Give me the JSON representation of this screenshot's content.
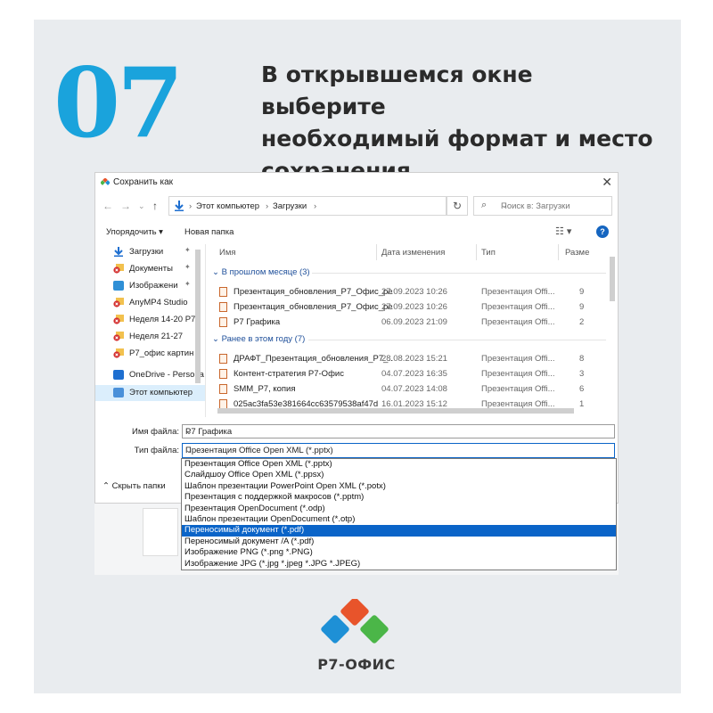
{
  "step": {
    "number": "07"
  },
  "headline": {
    "line1": "В открывшемся окне выберите",
    "line2": "необходимый формат и место",
    "line3": "сохранения"
  },
  "dialog": {
    "title": "Сохранить как",
    "close": "✕",
    "address": {
      "crumb1": "Этот компьютер",
      "crumb2": "Загрузки"
    },
    "search_placeholder": "Поиск в: Загрузки",
    "toolbar": {
      "organize": "Упорядочить ▾",
      "new_folder": "Новая папка",
      "help": "?"
    },
    "sidebar": [
      {
        "label": "Загрузки",
        "pin": true,
        "icon": "download-icon"
      },
      {
        "label": "Документы",
        "pin": true,
        "icon": "error-icon"
      },
      {
        "label": "Изображени",
        "pin": true,
        "icon": "pictures-icon"
      },
      {
        "label": "AnyMP4 Studio",
        "pin": false,
        "icon": "error-icon"
      },
      {
        "label": "Неделя 14-20 Р7",
        "pin": false,
        "icon": "error-icon"
      },
      {
        "label": "Неделя 21-27",
        "pin": false,
        "icon": "error-icon"
      },
      {
        "label": "Р7_офис картин",
        "pin": false,
        "icon": "error-icon"
      },
      {
        "label": "OneDrive - Persona",
        "pin": false,
        "icon": "onedrive-icon"
      },
      {
        "label": "Этот компьютер",
        "pin": false,
        "icon": "computer-icon"
      }
    ],
    "columns": {
      "name": "Имя",
      "date": "Дата изменения",
      "type": "Тип",
      "size": "Разме"
    },
    "groups": [
      {
        "title": "В прошлом месяце (3)",
        "rows": [
          {
            "name": "Презентация_обновления_Р7_Офис_ре...",
            "date": "27.09.2023 10:26",
            "type": "Презентация Offi...",
            "size": "9"
          },
          {
            "name": "Презентация_обновления_Р7_Офис_ре...",
            "date": "27.09.2023 10:26",
            "type": "Презентация Offi...",
            "size": "9"
          },
          {
            "name": "Р7 Графика",
            "date": "06.09.2023 21:09",
            "type": "Презентация Offi...",
            "size": "2"
          }
        ]
      },
      {
        "title": "Ранее в этом году (7)",
        "rows": [
          {
            "name": "ДРАФТ_Презентация_обновления_Р7_...",
            "date": "28.08.2023 15:21",
            "type": "Презентация Offi...",
            "size": "8"
          },
          {
            "name": "Контент-стратегия Р7-Офис",
            "date": "04.07.2023 16:35",
            "type": "Презентация Offi...",
            "size": "3"
          },
          {
            "name": "SMM_Р7, копия",
            "date": "04.07.2023 14:08",
            "type": "Презентация Offi...",
            "size": "6"
          },
          {
            "name": "025ac3fa53e381664cc63579538af47d",
            "date": "16.01.2023 15:12",
            "type": "Презентация Offi...",
            "size": "1"
          }
        ]
      }
    ],
    "file_name_label": "Имя файла:",
    "file_name_value": "Р7 Графика",
    "file_type_label": "Тип файла:",
    "file_type_value": "Презентация Office Open XML (*.pptx)",
    "hide_folders": "Скрыть папки",
    "type_options": [
      "Презентация Office Open XML (*.pptx)",
      "Слайдшоу Office Open XML (*.ppsx)",
      "Шаблон презентации PowerPoint Open XML (*.potx)",
      "Презентация с поддержкой макросов (*.pptm)",
      "Презентация OpenDocument (*.odp)",
      "Шаблон презентации OpenDocument (*.otp)",
      "Переносимый документ (*.pdf)",
      "Переносимый документ /A (*.pdf)",
      "Изображение PNG (*.png *.PNG)",
      "Изображение JPG (*.jpg *.jpeg *.JPG *.JPEG)"
    ],
    "selected_option_index": 6
  },
  "brand": {
    "name": "Р7-ОФИС",
    "colors": {
      "red": "#e8542b",
      "green": "#4bb648",
      "blue": "#1e90d6",
      "step": "#1aa3dc"
    }
  }
}
